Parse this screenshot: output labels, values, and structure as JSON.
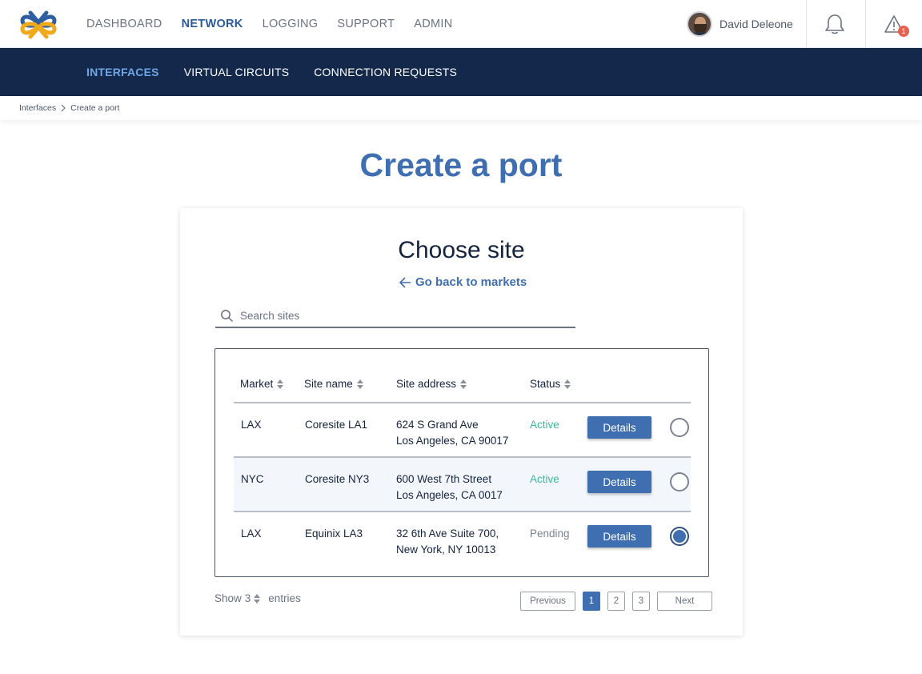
{
  "topnav": {
    "items": [
      {
        "label": "DASHBOARD",
        "active": false
      },
      {
        "label": "NETWORK",
        "active": true
      },
      {
        "label": "LOGGING",
        "active": false
      },
      {
        "label": "SUPPORT",
        "active": false
      },
      {
        "label": "ADMIN",
        "active": false
      }
    ],
    "user_name": "David Deleone",
    "alert_count": "1"
  },
  "subnav": {
    "items": [
      {
        "label": "INTERFACES",
        "active": true
      },
      {
        "label": "VIRTUAL CIRCUITS",
        "active": false
      },
      {
        "label": "CONNECTION REQUESTS",
        "active": false
      }
    ]
  },
  "breadcrumb": [
    "Interfaces",
    "Create a port"
  ],
  "page_title": "Create a port",
  "card": {
    "title": "Choose site",
    "back_link": "Go back to markets",
    "search_placeholder": "Search sites",
    "columns": [
      "Market",
      "Site name",
      "Site address",
      "Status"
    ],
    "rows": [
      {
        "market": "LAX",
        "site": "Coresite LA1",
        "address1": "624 S Grand Ave",
        "address2": "Los Angeles, CA 90017",
        "status": "Active",
        "details": "Details",
        "selected": false
      },
      {
        "market": "NYC",
        "site": "Coresite NY3",
        "address1": "600 West 7th Street",
        "address2": "Los Angeles, CA 0017",
        "status": "Active",
        "details": "Details",
        "selected": false
      },
      {
        "market": "LAX",
        "site": "Equinix LA3",
        "address1": "32 6th Ave Suite 700,",
        "address2": "New York, NY 10013",
        "status": "Pending",
        "details": "Details",
        "selected": true
      }
    ],
    "show_label": "Show",
    "show_count": "3",
    "entries_label": "entries",
    "pagination": {
      "previous": "Previous",
      "pages": [
        "1",
        "2",
        "3"
      ],
      "current": "1",
      "next": "Next"
    }
  },
  "colors": {
    "accent": "#3f6fb0",
    "navy": "#13284a",
    "active_status": "#3cb89a",
    "badge": "#e8614f"
  }
}
